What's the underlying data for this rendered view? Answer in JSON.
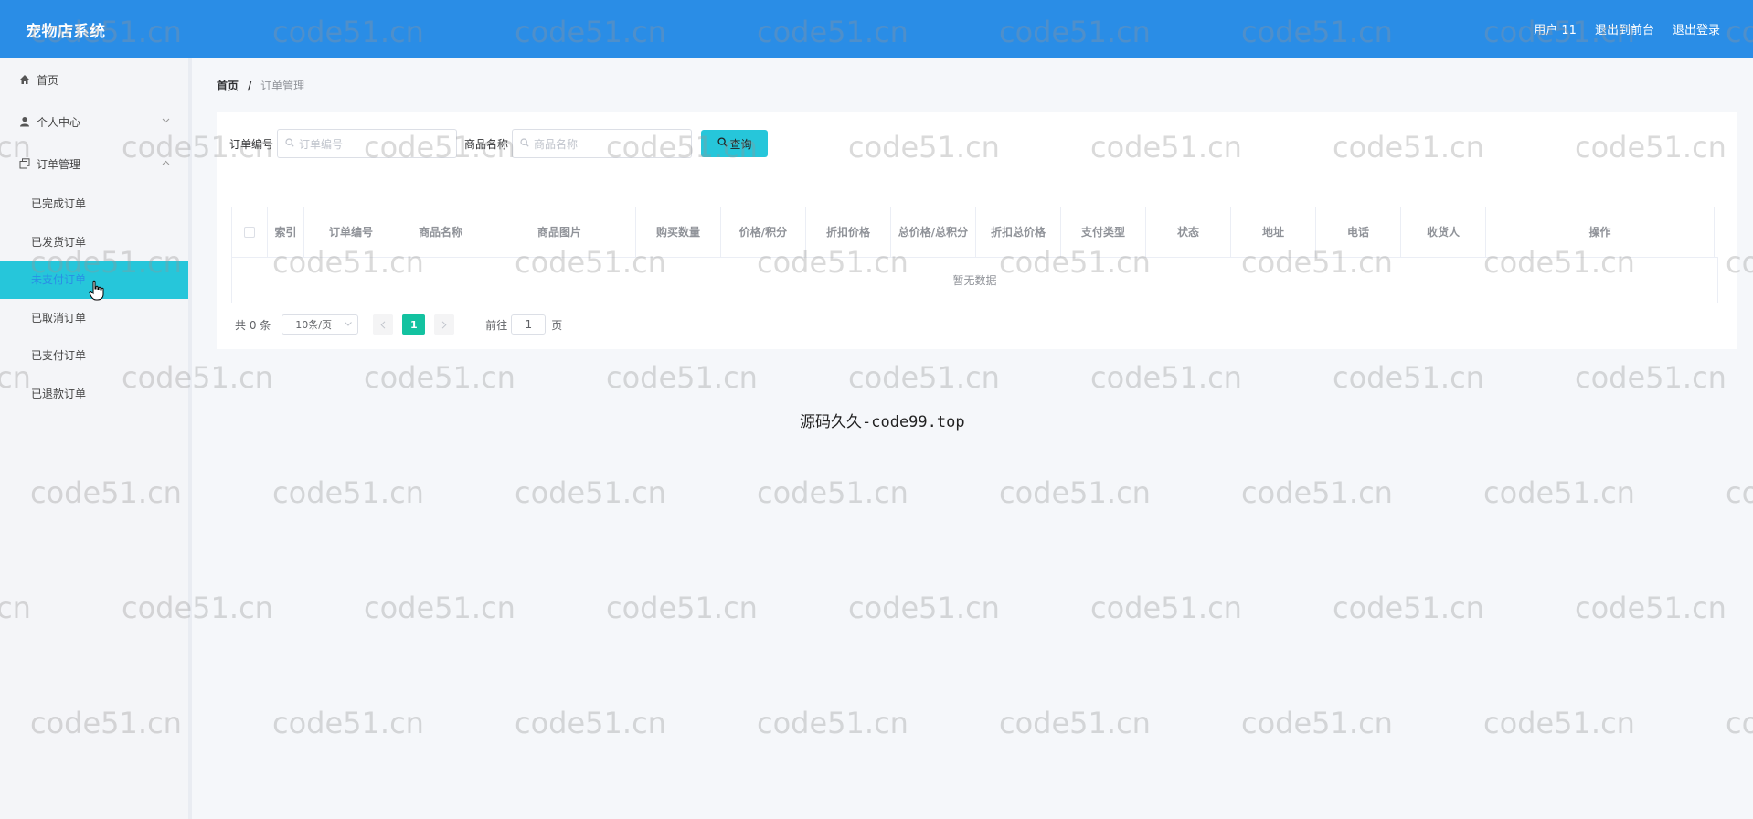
{
  "header": {
    "brand": "宠物店系统",
    "user_label": "用户 11",
    "front_label": "退出到前台",
    "logout_label": "退出登录",
    "bg_color": "#2a8de6"
  },
  "sidebar": {
    "home": {
      "label": "首页",
      "icon": "home-icon"
    },
    "personal": {
      "label": "个人中心",
      "icon": "user-icon"
    },
    "orders": {
      "label": "订单管理",
      "icon": "copy-icon",
      "items": [
        {
          "label": "已完成订单"
        },
        {
          "label": "已发货订单"
        },
        {
          "label": "未支付订单",
          "active": true
        },
        {
          "label": "已取消订单"
        },
        {
          "label": "已支付订单"
        },
        {
          "label": "已退款订单"
        }
      ]
    },
    "active_color": "#26c6da"
  },
  "breadcrumb": {
    "home": "首页",
    "sep": "/",
    "current": "订单管理"
  },
  "search": {
    "order_no_label": "订单编号",
    "order_no_placeholder": "订单编号",
    "product_label": "商品名称",
    "product_placeholder": "商品名称",
    "button_label": "查询"
  },
  "table": {
    "columns": [
      "索引",
      "订单编号",
      "商品名称",
      "商品图片",
      "购买数量",
      "价格/积分",
      "折扣价格",
      "总价格/总积分",
      "折扣总价格",
      "支付类型",
      "状态",
      "地址",
      "电话",
      "收货人",
      "操作"
    ],
    "empty_text": "暂无数据"
  },
  "pager": {
    "total": "共 0 条",
    "page_size": "10条/页",
    "current_page": "1",
    "goto_label": "前往",
    "goto_value": "1",
    "page_suffix": "页"
  },
  "footer_text": "源码久久-code99.top",
  "watermark": "code51.cn"
}
